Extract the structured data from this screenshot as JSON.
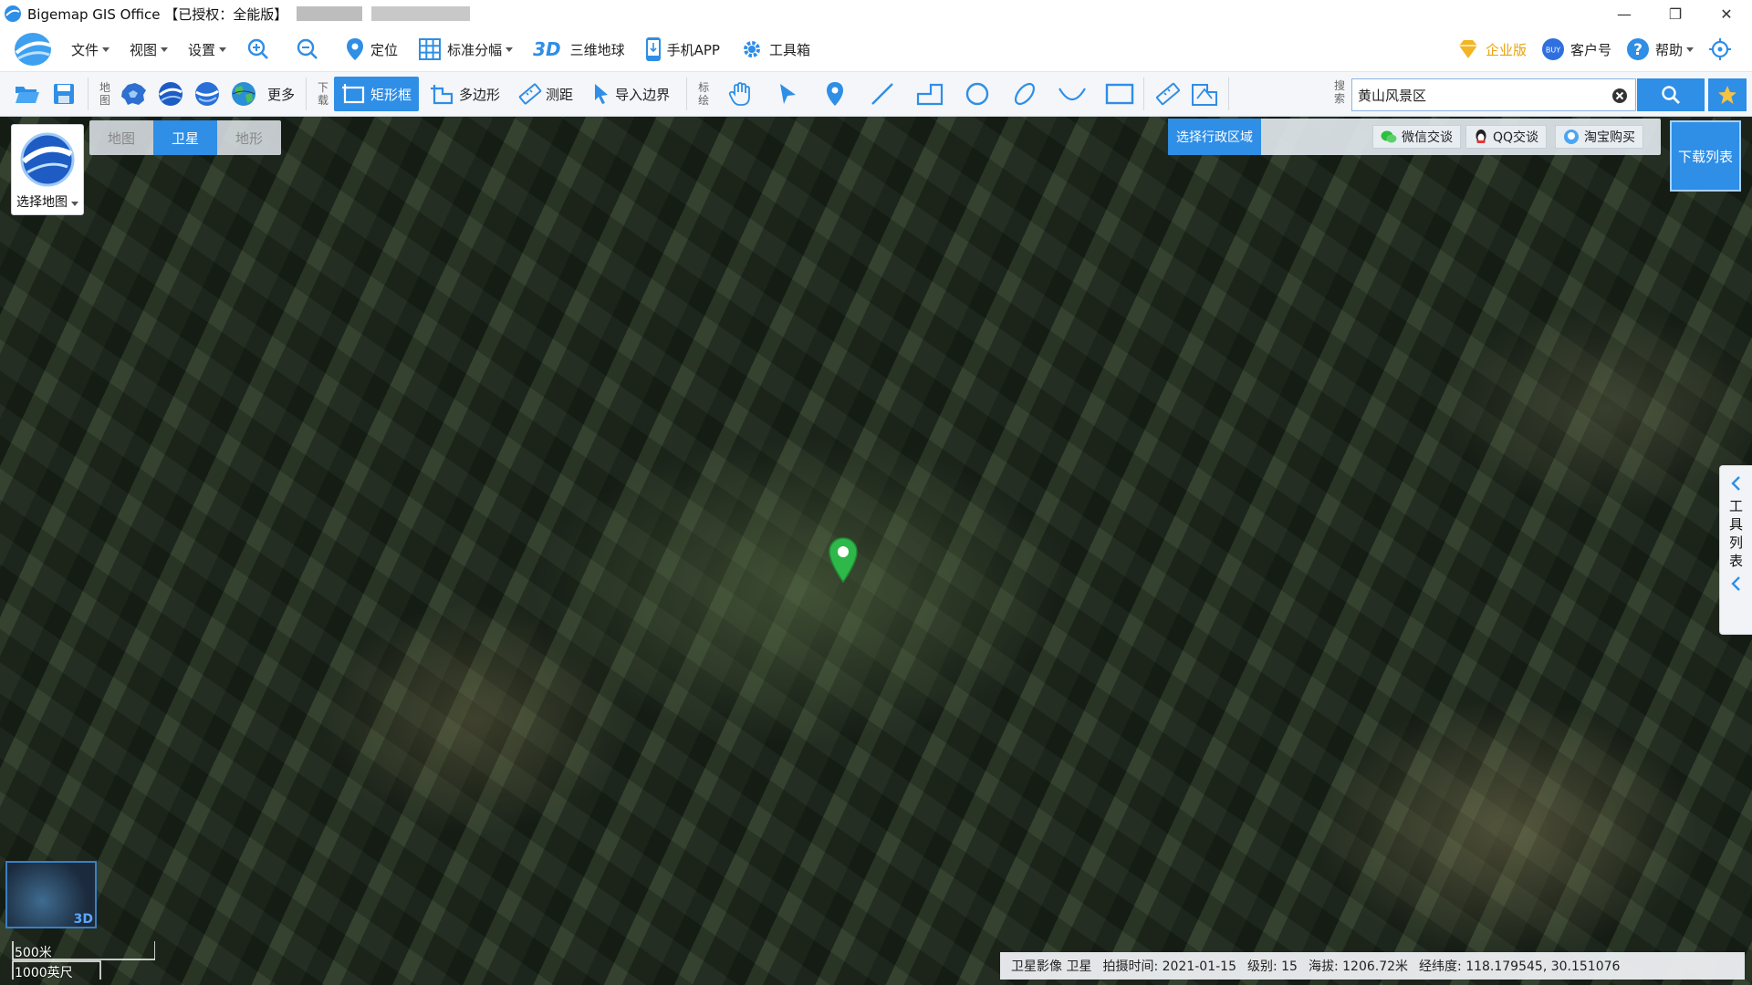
{
  "titlebar": {
    "title": "Bigemap GIS Office 【已授权：全能版】",
    "minimize": "—",
    "restore": "❐",
    "close": "✕"
  },
  "menubar": {
    "file": "文件",
    "view": "视图",
    "settings": "设置",
    "locate": "定位",
    "standard_sheet": "标准分幅",
    "three_d_label": "3D",
    "globe3d": "三维地球",
    "mobile_app": "手机APP",
    "toolbox": "工具箱",
    "enterprise": "企业版",
    "customer": "客户号",
    "help": "帮助"
  },
  "toolbar": {
    "map_label": "地图",
    "more": "更多",
    "download_label": "下载",
    "rect": "矩形框",
    "polygon": "多边形",
    "measure": "测距",
    "import_boundary": "导入边界",
    "annotate_label": "标绘",
    "search_label": "搜索",
    "search_value": "黄山风景区"
  },
  "map": {
    "select_map": "选择地图",
    "tabs": [
      "地图",
      "卫星",
      "地形"
    ],
    "active_tab": 1,
    "admin_region": "选择行政区域",
    "wechat": "微信交谈",
    "qq": "QQ交谈",
    "taobao": "淘宝购买",
    "download_list": "下载列表",
    "tool_list": "工具列表",
    "minimap_3d": "3D",
    "scale_metric": "500米",
    "scale_imperial": "1000英尺"
  },
  "status": {
    "source": "卫星影像 卫星",
    "capture_time": "拍摄时间: 2021-01-15",
    "level": "级别: 15",
    "elevation": "海拔: 1206.72米",
    "lnglat": "经纬度: 118.179545, 30.151076"
  },
  "colors": {
    "accent": "#2f8ee6",
    "enterprise": "#e9a20e",
    "pin": "#2eb84a"
  }
}
